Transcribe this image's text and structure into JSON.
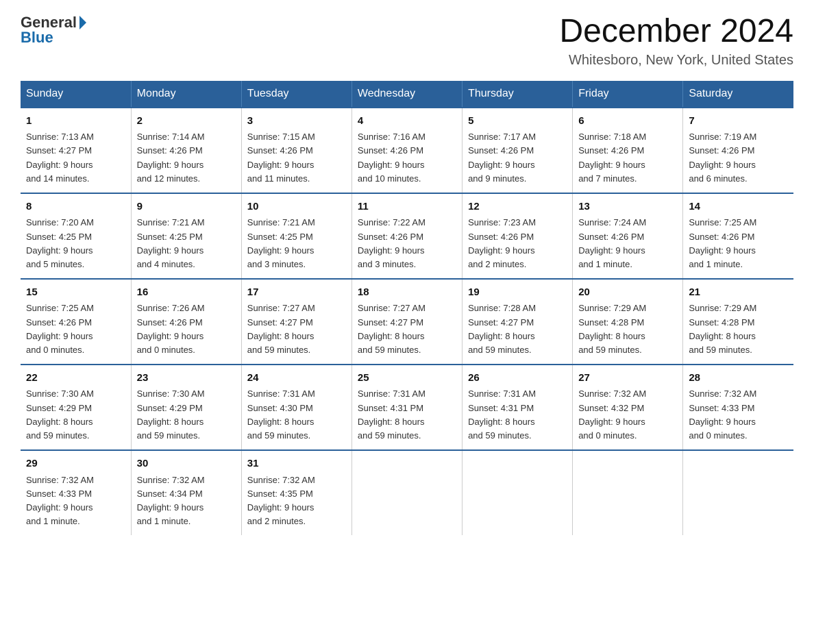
{
  "logo": {
    "general": "General",
    "blue": "Blue"
  },
  "title": "December 2024",
  "location": "Whitesboro, New York, United States",
  "days_of_week": [
    "Sunday",
    "Monday",
    "Tuesday",
    "Wednesday",
    "Thursday",
    "Friday",
    "Saturday"
  ],
  "weeks": [
    [
      {
        "day": "1",
        "info": "Sunrise: 7:13 AM\nSunset: 4:27 PM\nDaylight: 9 hours\nand 14 minutes."
      },
      {
        "day": "2",
        "info": "Sunrise: 7:14 AM\nSunset: 4:26 PM\nDaylight: 9 hours\nand 12 minutes."
      },
      {
        "day": "3",
        "info": "Sunrise: 7:15 AM\nSunset: 4:26 PM\nDaylight: 9 hours\nand 11 minutes."
      },
      {
        "day": "4",
        "info": "Sunrise: 7:16 AM\nSunset: 4:26 PM\nDaylight: 9 hours\nand 10 minutes."
      },
      {
        "day": "5",
        "info": "Sunrise: 7:17 AM\nSunset: 4:26 PM\nDaylight: 9 hours\nand 9 minutes."
      },
      {
        "day": "6",
        "info": "Sunrise: 7:18 AM\nSunset: 4:26 PM\nDaylight: 9 hours\nand 7 minutes."
      },
      {
        "day": "7",
        "info": "Sunrise: 7:19 AM\nSunset: 4:26 PM\nDaylight: 9 hours\nand 6 minutes."
      }
    ],
    [
      {
        "day": "8",
        "info": "Sunrise: 7:20 AM\nSunset: 4:25 PM\nDaylight: 9 hours\nand 5 minutes."
      },
      {
        "day": "9",
        "info": "Sunrise: 7:21 AM\nSunset: 4:25 PM\nDaylight: 9 hours\nand 4 minutes."
      },
      {
        "day": "10",
        "info": "Sunrise: 7:21 AM\nSunset: 4:25 PM\nDaylight: 9 hours\nand 3 minutes."
      },
      {
        "day": "11",
        "info": "Sunrise: 7:22 AM\nSunset: 4:26 PM\nDaylight: 9 hours\nand 3 minutes."
      },
      {
        "day": "12",
        "info": "Sunrise: 7:23 AM\nSunset: 4:26 PM\nDaylight: 9 hours\nand 2 minutes."
      },
      {
        "day": "13",
        "info": "Sunrise: 7:24 AM\nSunset: 4:26 PM\nDaylight: 9 hours\nand 1 minute."
      },
      {
        "day": "14",
        "info": "Sunrise: 7:25 AM\nSunset: 4:26 PM\nDaylight: 9 hours\nand 1 minute."
      }
    ],
    [
      {
        "day": "15",
        "info": "Sunrise: 7:25 AM\nSunset: 4:26 PM\nDaylight: 9 hours\nand 0 minutes."
      },
      {
        "day": "16",
        "info": "Sunrise: 7:26 AM\nSunset: 4:26 PM\nDaylight: 9 hours\nand 0 minutes."
      },
      {
        "day": "17",
        "info": "Sunrise: 7:27 AM\nSunset: 4:27 PM\nDaylight: 8 hours\nand 59 minutes."
      },
      {
        "day": "18",
        "info": "Sunrise: 7:27 AM\nSunset: 4:27 PM\nDaylight: 8 hours\nand 59 minutes."
      },
      {
        "day": "19",
        "info": "Sunrise: 7:28 AM\nSunset: 4:27 PM\nDaylight: 8 hours\nand 59 minutes."
      },
      {
        "day": "20",
        "info": "Sunrise: 7:29 AM\nSunset: 4:28 PM\nDaylight: 8 hours\nand 59 minutes."
      },
      {
        "day": "21",
        "info": "Sunrise: 7:29 AM\nSunset: 4:28 PM\nDaylight: 8 hours\nand 59 minutes."
      }
    ],
    [
      {
        "day": "22",
        "info": "Sunrise: 7:30 AM\nSunset: 4:29 PM\nDaylight: 8 hours\nand 59 minutes."
      },
      {
        "day": "23",
        "info": "Sunrise: 7:30 AM\nSunset: 4:29 PM\nDaylight: 8 hours\nand 59 minutes."
      },
      {
        "day": "24",
        "info": "Sunrise: 7:31 AM\nSunset: 4:30 PM\nDaylight: 8 hours\nand 59 minutes."
      },
      {
        "day": "25",
        "info": "Sunrise: 7:31 AM\nSunset: 4:31 PM\nDaylight: 8 hours\nand 59 minutes."
      },
      {
        "day": "26",
        "info": "Sunrise: 7:31 AM\nSunset: 4:31 PM\nDaylight: 8 hours\nand 59 minutes."
      },
      {
        "day": "27",
        "info": "Sunrise: 7:32 AM\nSunset: 4:32 PM\nDaylight: 9 hours\nand 0 minutes."
      },
      {
        "day": "28",
        "info": "Sunrise: 7:32 AM\nSunset: 4:33 PM\nDaylight: 9 hours\nand 0 minutes."
      }
    ],
    [
      {
        "day": "29",
        "info": "Sunrise: 7:32 AM\nSunset: 4:33 PM\nDaylight: 9 hours\nand 1 minute."
      },
      {
        "day": "30",
        "info": "Sunrise: 7:32 AM\nSunset: 4:34 PM\nDaylight: 9 hours\nand 1 minute."
      },
      {
        "day": "31",
        "info": "Sunrise: 7:32 AM\nSunset: 4:35 PM\nDaylight: 9 hours\nand 2 minutes."
      },
      {
        "day": "",
        "info": ""
      },
      {
        "day": "",
        "info": ""
      },
      {
        "day": "",
        "info": ""
      },
      {
        "day": "",
        "info": ""
      }
    ]
  ]
}
